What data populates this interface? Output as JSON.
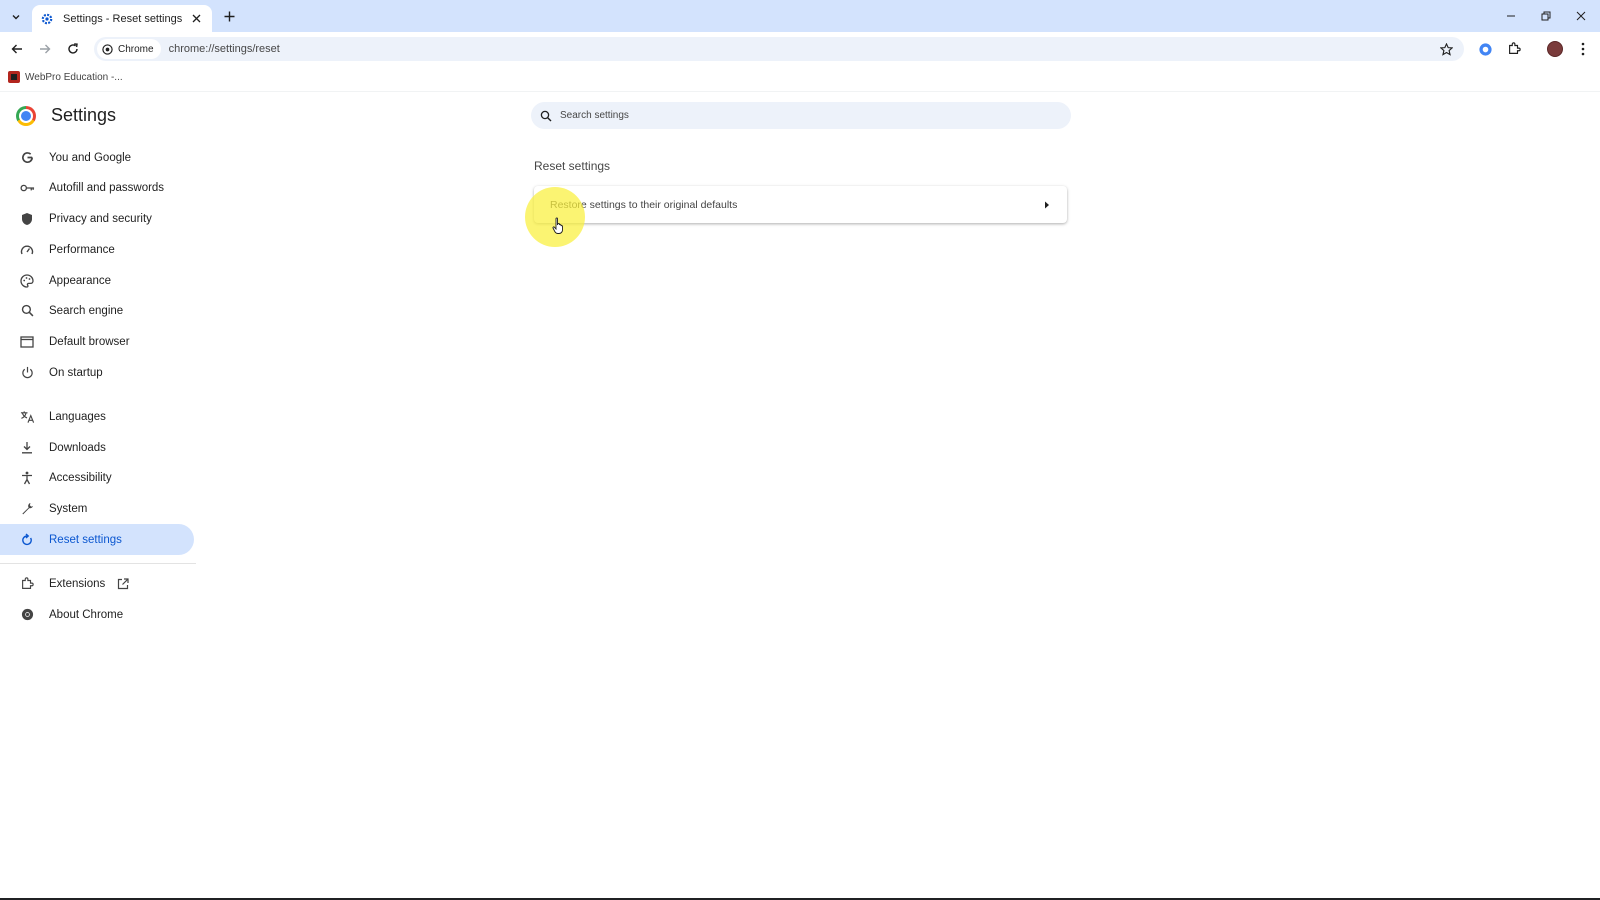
{
  "browser": {
    "tab": {
      "title": "Settings - Reset settings"
    },
    "omnibox": {
      "chip_label": "Chrome",
      "url": "chrome://settings/reset"
    },
    "bookmarks": [
      {
        "label": "WebPro Education -..."
      }
    ]
  },
  "settings": {
    "title": "Settings",
    "search": {
      "placeholder": "Search settings"
    },
    "nav": {
      "items": [
        {
          "label": "You and Google",
          "icon": "google-g-icon"
        },
        {
          "label": "Autofill and passwords",
          "icon": "key-icon"
        },
        {
          "label": "Privacy and security",
          "icon": "shield-icon"
        },
        {
          "label": "Performance",
          "icon": "gauge-icon"
        },
        {
          "label": "Appearance",
          "icon": "palette-icon"
        },
        {
          "label": "Search engine",
          "icon": "search-icon"
        },
        {
          "label": "Default browser",
          "icon": "browser-window-icon"
        },
        {
          "label": "On startup",
          "icon": "power-icon"
        },
        {
          "label": "Languages",
          "icon": "translate-icon"
        },
        {
          "label": "Downloads",
          "icon": "download-icon"
        },
        {
          "label": "Accessibility",
          "icon": "accessibility-icon"
        },
        {
          "label": "System",
          "icon": "wrench-icon"
        },
        {
          "label": "Reset settings",
          "icon": "reset-icon",
          "active": true
        },
        {
          "label": "Extensions",
          "icon": "puzzle-icon"
        },
        {
          "label": "About Chrome",
          "icon": "chrome-icon"
        }
      ]
    },
    "section_title": "Reset settings",
    "reset_row": {
      "label": "Restore settings to their original defaults"
    }
  },
  "colors": {
    "active_nav_bg": "#d3e3fd",
    "active_nav_text": "#0b57d0",
    "tabstrip_bg": "#d3e3fd",
    "click_highlight": "#faf03c"
  }
}
